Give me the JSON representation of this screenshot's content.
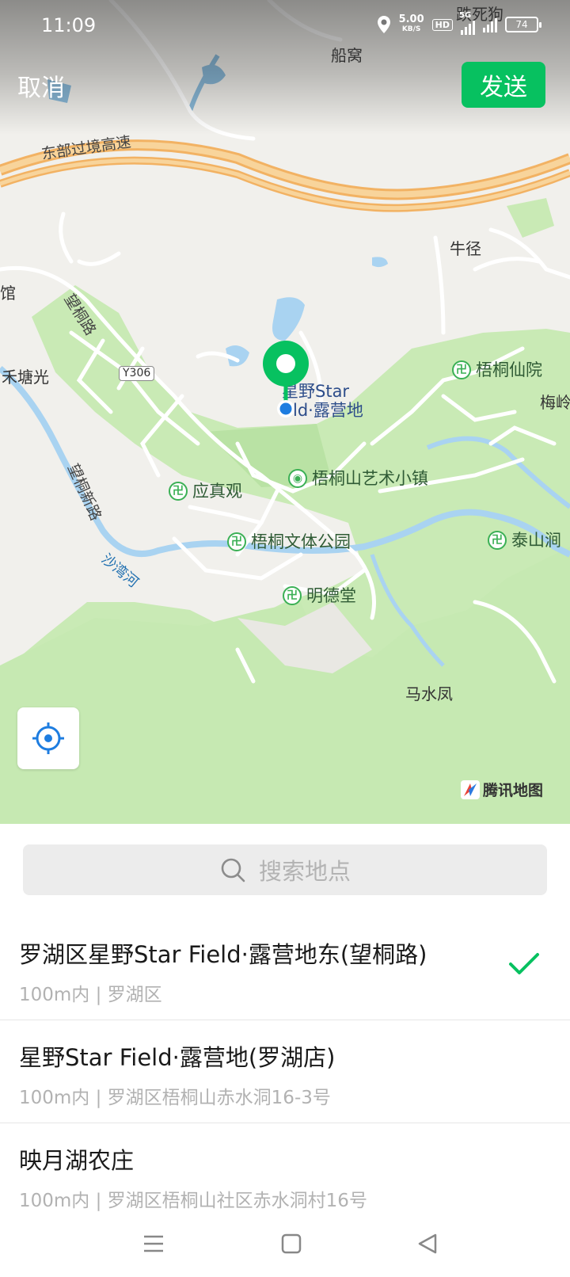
{
  "status_bar": {
    "time": "11:09",
    "net_speed_value": "5.00",
    "net_speed_unit": "KB/S",
    "hd_label": "HD",
    "network_label": "5G",
    "battery": "74"
  },
  "header": {
    "cancel_label": "取消",
    "send_label": "发送",
    "send_color": "#07c160"
  },
  "map": {
    "place_labels": [
      {
        "id": "chuanwo",
        "text": "船窝"
      },
      {
        "id": "diesigou",
        "text": "跌死狗"
      },
      {
        "id": "niujing",
        "text": "牛径"
      },
      {
        "id": "hetangguang",
        "text": "禾塘光"
      },
      {
        "id": "meiling",
        "text": "梅岭"
      },
      {
        "id": "mashuifeng",
        "text": "马水凤"
      },
      {
        "id": "guan",
        "text": "馆"
      }
    ],
    "road_labels": {
      "expressway": "东部过境高速",
      "wangtong": "望桐路",
      "wangtong_new": "望桐新路",
      "y306": "Y306"
    },
    "water_labels": {
      "shawan": "沙湾河"
    },
    "pois": [
      {
        "id": "wutong-xianyuan",
        "text": "梧桐仙院"
      },
      {
        "id": "yingzhen",
        "text": "应真观"
      },
      {
        "id": "wutong-town",
        "text": "梧桐山艺术小镇"
      },
      {
        "id": "wutong-park",
        "text": "梧桐文体公园"
      },
      {
        "id": "mingde",
        "text": "明德堂"
      },
      {
        "id": "taishan",
        "text": "泰山涧"
      }
    ],
    "selected_place_line1": "星野Star",
    "selected_place_line2": "ld·露营地",
    "brand": "腾讯地图"
  },
  "search": {
    "placeholder": "搜索地点"
  },
  "results": [
    {
      "title": "罗湖区星野Star Field·露营地东(望桐路)",
      "subtitle": "100m内 | 罗湖区",
      "selected": true
    },
    {
      "title": "星野Star Field·露营地(罗湖店)",
      "subtitle": "100m内 | 罗湖区梧桐山赤水洞16-3号",
      "selected": false
    },
    {
      "title": "映月湖农庄",
      "subtitle": "100m内 | 罗湖区梧桐山社区赤水洞村16号",
      "selected": false
    }
  ]
}
